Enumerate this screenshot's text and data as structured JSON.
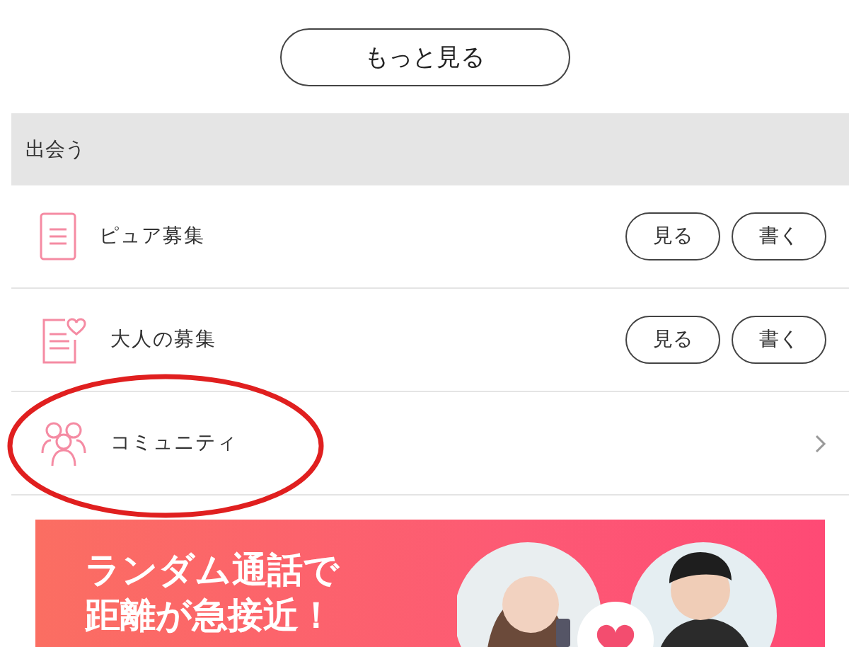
{
  "more_button": "もっと見る",
  "section": {
    "title": "出会う",
    "items": [
      {
        "kind": "actions",
        "label": "ピュア募集",
        "buttons": [
          "見る",
          "書く"
        ],
        "circled": false
      },
      {
        "kind": "actions",
        "label": "大人の募集",
        "buttons": [
          "見る",
          "書く"
        ],
        "circled": false
      },
      {
        "kind": "link",
        "label": "コミュニティ",
        "circled": true
      }
    ]
  },
  "banner": {
    "lines": [
      "ランダム通話で",
      "距離が急接近！"
    ],
    "kind": "picture"
  }
}
